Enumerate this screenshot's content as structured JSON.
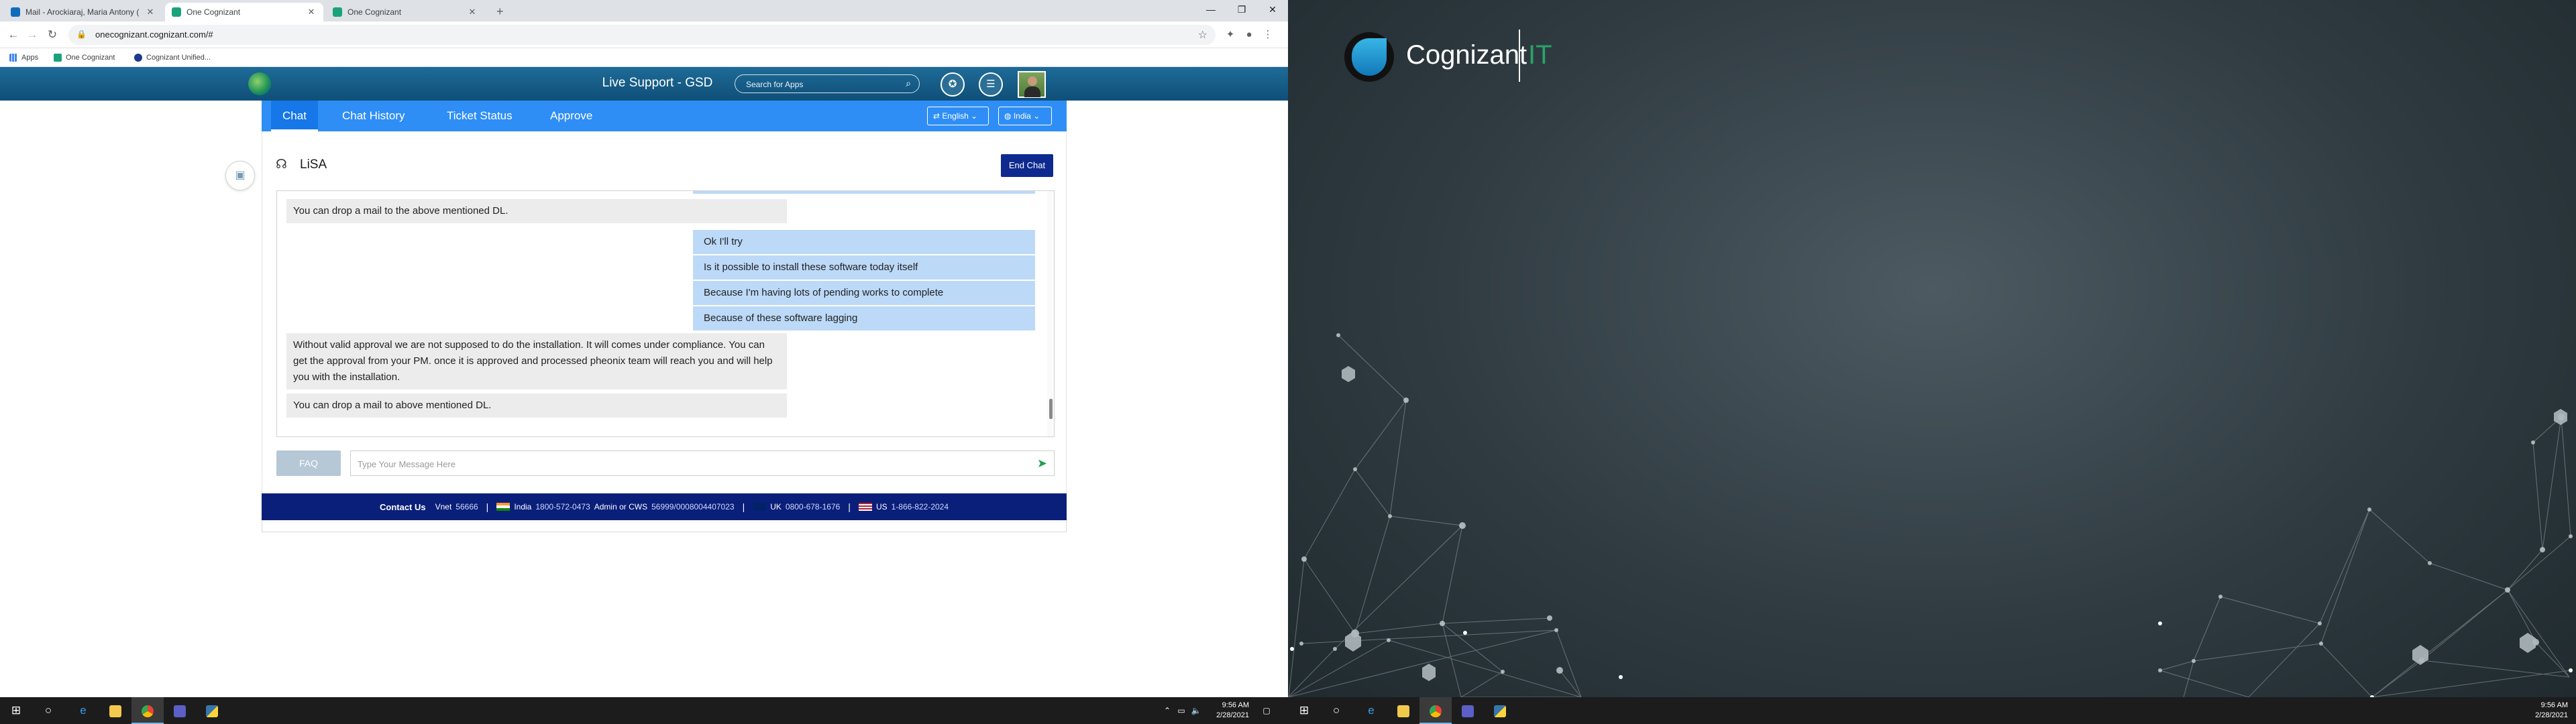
{
  "browser": {
    "tabs": [
      {
        "label": "Mail - Arockiaraj, Maria Antony (",
        "active": false,
        "favicon_color": "#0f6cbd"
      },
      {
        "label": "One Cognizant",
        "active": true,
        "favicon_color": "#1aa37a"
      },
      {
        "label": "One Cognizant",
        "active": false,
        "favicon_color": "#1aa37a"
      }
    ],
    "url": "onecognizant.cognizant.com/#",
    "bookmarks": [
      {
        "label": "Apps"
      },
      {
        "label": "One Cognizant"
      },
      {
        "label": "Cognizant Unified..."
      }
    ]
  },
  "app": {
    "title": "Live Support - GSD",
    "search_placeholder": "Search for Apps",
    "nav": [
      {
        "label": "Chat",
        "active": true
      },
      {
        "label": "Chat History",
        "active": false
      },
      {
        "label": "Ticket Status",
        "active": false
      },
      {
        "label": "Approve",
        "active": false
      }
    ],
    "language": "English",
    "country": "India"
  },
  "chat": {
    "agent_name": "LiSA",
    "end_chat_label": "End Chat",
    "messages": [
      {
        "from": "bot",
        "text": "You can drop a mail to the above mentioned DL."
      },
      {
        "from": "user",
        "text": "Ok I'll try"
      },
      {
        "from": "user",
        "text": "Is it possible to install these software today itself"
      },
      {
        "from": "user",
        "text": "Because I'm having lots of pending works to complete"
      },
      {
        "from": "user",
        "text": "Because of these software lagging"
      },
      {
        "from": "bot",
        "text": "Without valid approval we are not supposed to do the installation. It will comes under compliance. You can get the approval from your PM. once it is approved and processed pheonix team will reach you and will help you with the installation."
      },
      {
        "from": "bot",
        "text": "You can drop a mail to above mentioned DL."
      }
    ],
    "faq_label": "FAQ",
    "input_placeholder": "Type Your Message Here"
  },
  "contact": {
    "title": "Contact Us",
    "vnet_label": "Vnet",
    "vnet_value": "56666",
    "india_label": "India",
    "india_value": "1800-572-0473",
    "admin_label": "Admin or CWS",
    "admin_value": "56999/0008004407023",
    "uk_label": "UK",
    "uk_value": "0800-678-1676",
    "us_label": "US",
    "us_value": "1-866-822-2024"
  },
  "taskbar_left": {
    "time": "9:56 AM",
    "date": "2/28/2021"
  },
  "taskbar_right": {
    "time": "9:56 AM",
    "date": "2/28/2021"
  },
  "wallpaper": {
    "brand": "Cognizant",
    "suffix": "IT"
  },
  "colors": {
    "nav_blue": "#2f8ef5",
    "header_blue": "#1e6b98",
    "end_chat": "#0e2a8f",
    "user_bubble": "#bcd9f8",
    "bot_bubble": "#ececec",
    "contact_bar": "#0a1f7a"
  }
}
